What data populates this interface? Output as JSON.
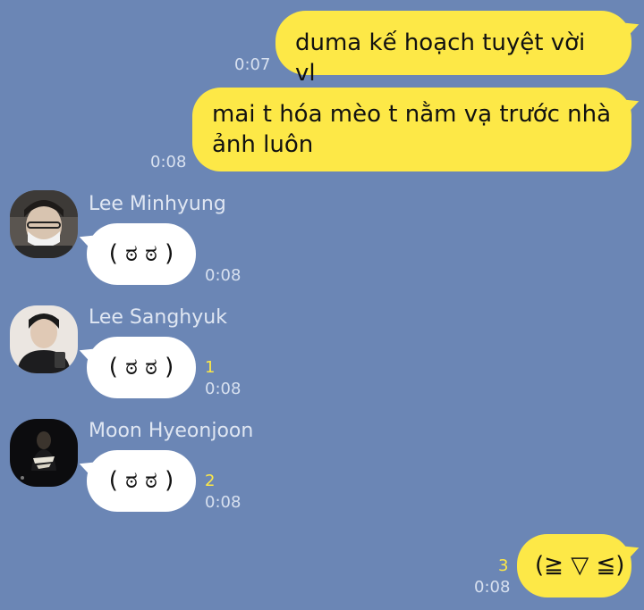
{
  "messages": [
    {
      "text": "duma kế hoạch tuyệt vời vl",
      "time": "0:07"
    },
    {
      "text": "mai t hóa mèo t nằm vạ trước nhà ảnh luôn",
      "time": "0:08"
    },
    {
      "sender": "Lee Minhyung",
      "text": "( ಠ ಠ )",
      "time": "0:08",
      "unread": ""
    },
    {
      "sender": "Lee Sanghyuk",
      "text": "( ಠ ಠ )",
      "time": "0:08",
      "unread": "1"
    },
    {
      "sender": "Moon Hyeonjoon",
      "text": "( ಠ ಠ )",
      "time": "0:08",
      "unread": "2"
    },
    {
      "text": "(≧ ▽ ≦)",
      "time": "0:08",
      "unread": "3"
    }
  ],
  "colors": {
    "background": "#6b86b5",
    "outgoing_bubble": "#fde847",
    "incoming_bubble": "#ffffff",
    "unread_count": "#fde847"
  },
  "icons": {
    "avatar_lee_minhyung": "avatar-masked-person",
    "avatar_lee_sanghyuk": "avatar-hoodie-person",
    "avatar_moon_hyeonjoon": "avatar-dark-photo"
  }
}
